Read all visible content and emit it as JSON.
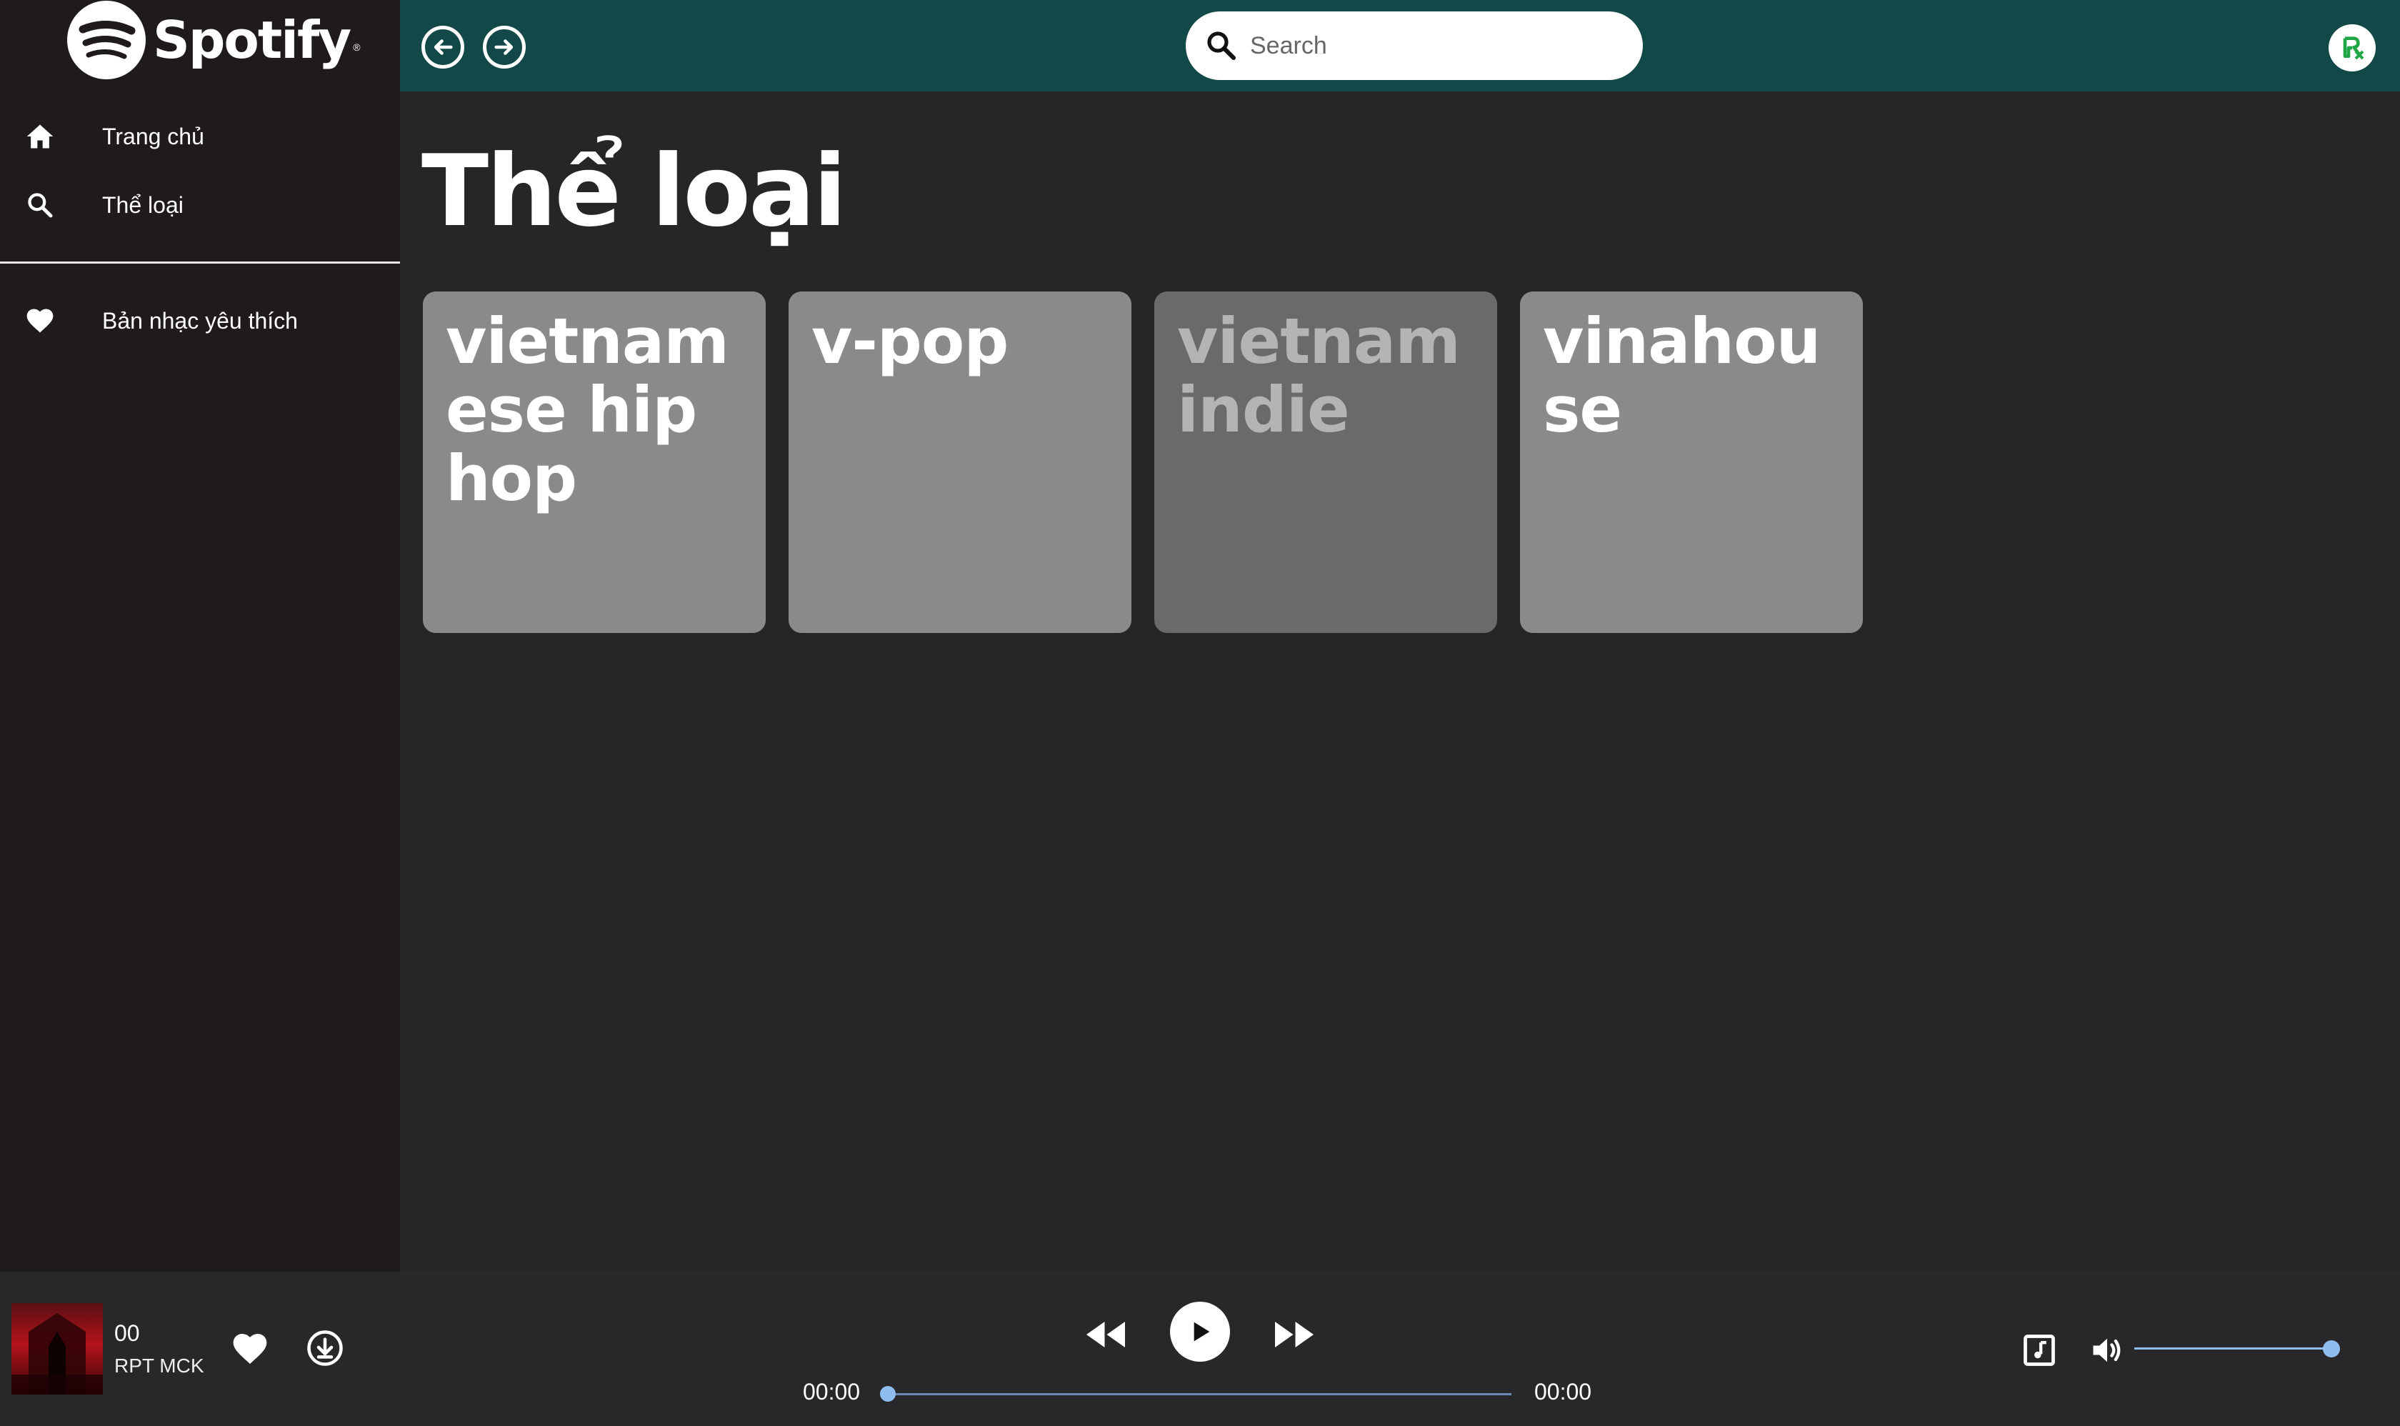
{
  "app": {
    "name": "Spotify",
    "reg_mark": "®"
  },
  "sidebar": {
    "items": [
      {
        "label": "Trang chủ",
        "icon": "home-icon"
      },
      {
        "label": "Thể loại",
        "icon": "search-icon"
      },
      {
        "label": "Bản nhạc yêu thích",
        "icon": "heart-icon"
      }
    ]
  },
  "topbar": {
    "back_icon": "arrow-left-circle-icon",
    "forward_icon": "arrow-right-circle-icon",
    "search_placeholder": "Search",
    "search_value": "",
    "avatar_icon": "user-avatar-icon"
  },
  "main": {
    "title": "Thể loại",
    "genres": [
      {
        "label": "vietnamese hip hop",
        "color": "#8a8a8a",
        "text_color": "#ffffff"
      },
      {
        "label": "v-pop",
        "color": "#8a8a8a",
        "text_color": "#ffffff"
      },
      {
        "label": "vietnam indie",
        "color": "#6a6a6a",
        "text_color": "#b4b4b4"
      },
      {
        "label": "vinahouse",
        "color": "#8a8a8a",
        "text_color": "#ffffff"
      }
    ]
  },
  "player": {
    "song_title": "00",
    "artist": "RPT MCK",
    "time_current": "00:00",
    "time_total": "00:00",
    "progress": 0,
    "volume": 1.0,
    "icons": {
      "like": "heart-icon",
      "download": "download-circle-icon",
      "prev": "rewind-icon",
      "play": "play-icon",
      "next": "fast-forward-icon",
      "lyrics": "lyrics-note-icon",
      "volume": "volume-icon"
    }
  },
  "colors": {
    "topbar": "#124847",
    "sidebar": "#1e1b1a",
    "main_bg": "#282525",
    "player_bg": "#28272a",
    "accent_blue": "#8fbdf0",
    "avatar_green": "#20a646"
  }
}
